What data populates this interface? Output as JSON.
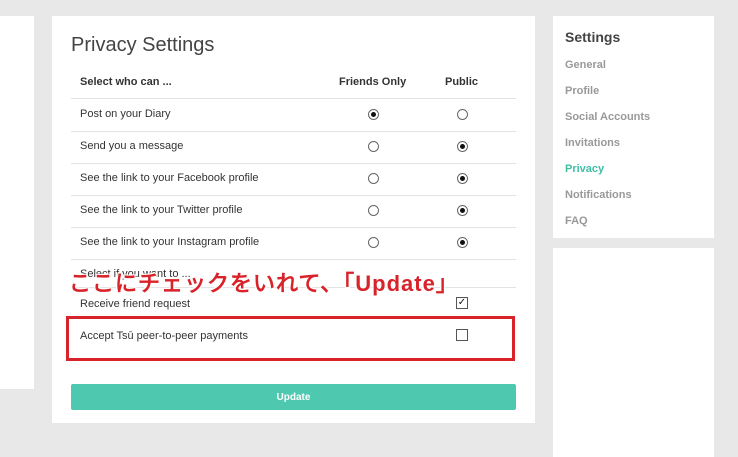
{
  "privacy": {
    "title": "Privacy Settings",
    "header": {
      "label": "Select who can ...",
      "friends": "Friends Only",
      "public": "Public"
    },
    "rows": [
      {
        "label": "Post on your Diary",
        "friends": true,
        "public": false
      },
      {
        "label": "Send you a message",
        "friends": false,
        "public": true
      },
      {
        "label": "See the link to your Facebook profile",
        "friends": false,
        "public": true
      },
      {
        "label": "See the link to your Twitter profile",
        "friends": false,
        "public": true
      },
      {
        "label": "See the link to your Instagram profile",
        "friends": false,
        "public": true
      }
    ],
    "section_label": "Select if you want to ...",
    "checks": [
      {
        "label": "Receive friend request",
        "checked": true
      },
      {
        "label": "Accept Tsū peer-to-peer payments",
        "checked": false
      }
    ],
    "update_label": "Update"
  },
  "annotation": {
    "text": "ここにチェックをいれて、「Update」",
    "color": "#d8232a"
  },
  "settings": {
    "title": "Settings",
    "items": [
      "General",
      "Profile",
      "Social Accounts",
      "Invitations",
      "Privacy",
      "Notifications",
      "FAQ"
    ],
    "active": "Privacy"
  },
  "colors": {
    "accent": "#4ec9af",
    "annotation": "#d8232a"
  }
}
